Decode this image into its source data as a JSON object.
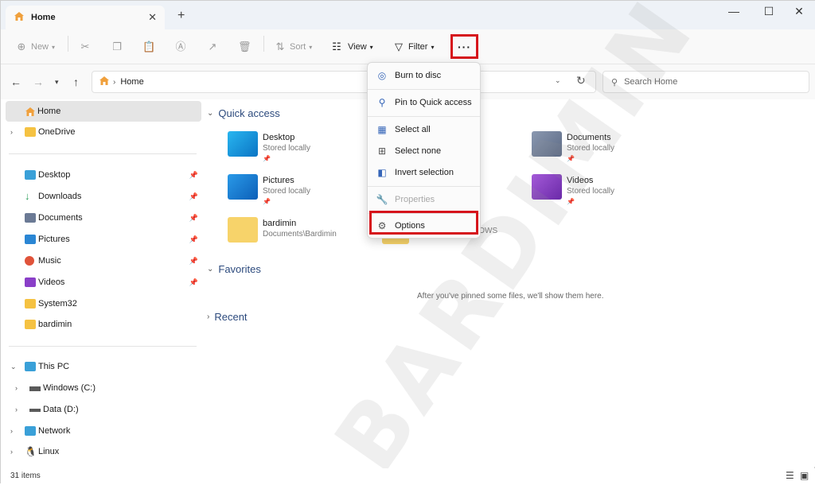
{
  "tab": {
    "title": "Home",
    "close": "✕",
    "new": "+"
  },
  "window_controls": {
    "minimize": "—",
    "maximize": "☐",
    "close": "✕"
  },
  "commandbar": {
    "new": "New",
    "sort": "Sort",
    "view": "View",
    "filter": "Filter",
    "more": "···"
  },
  "address": {
    "path": "Home",
    "search_placeholder": "Search Home"
  },
  "sidebar": {
    "items": [
      {
        "label": "Home"
      },
      {
        "label": "OneDrive"
      },
      {
        "label": "Desktop"
      },
      {
        "label": "Downloads"
      },
      {
        "label": "Documents"
      },
      {
        "label": "Pictures"
      },
      {
        "label": "Music"
      },
      {
        "label": "Videos"
      },
      {
        "label": "System32"
      },
      {
        "label": "bardimin"
      },
      {
        "label": "This PC"
      },
      {
        "label": "Windows (C:)"
      },
      {
        "label": "Data (D:)"
      },
      {
        "label": "Network"
      },
      {
        "label": "Linux"
      }
    ]
  },
  "main": {
    "quick_access": "Quick access",
    "favorites": "Favorites",
    "recent": "Recent",
    "favorites_empty": "After you've pinned some files, we'll show them here.",
    "items": [
      {
        "name": "Desktop",
        "sub": "Stored locally"
      },
      {
        "name": "Pictures",
        "sub": "Stored locally"
      },
      {
        "name": "bardimin",
        "sub": "Documents\\Bardimin"
      },
      {
        "name": "Documents",
        "sub": "Stored locally"
      },
      {
        "name": "Videos",
        "sub": "Stored locally"
      },
      {
        "partial": "DOWS"
      }
    ]
  },
  "menu": {
    "burn": "Burn to disc",
    "pin": "Pin to Quick access",
    "select_all": "Select all",
    "select_none": "Select none",
    "invert": "Invert selection",
    "properties": "Properties",
    "options": "Options"
  },
  "watermark": "BARDIMIN",
  "status": {
    "count": "31 items"
  },
  "colors": {
    "highlight": "#d6141c",
    "accent": "#3565b8",
    "folder": "#f5c242"
  }
}
